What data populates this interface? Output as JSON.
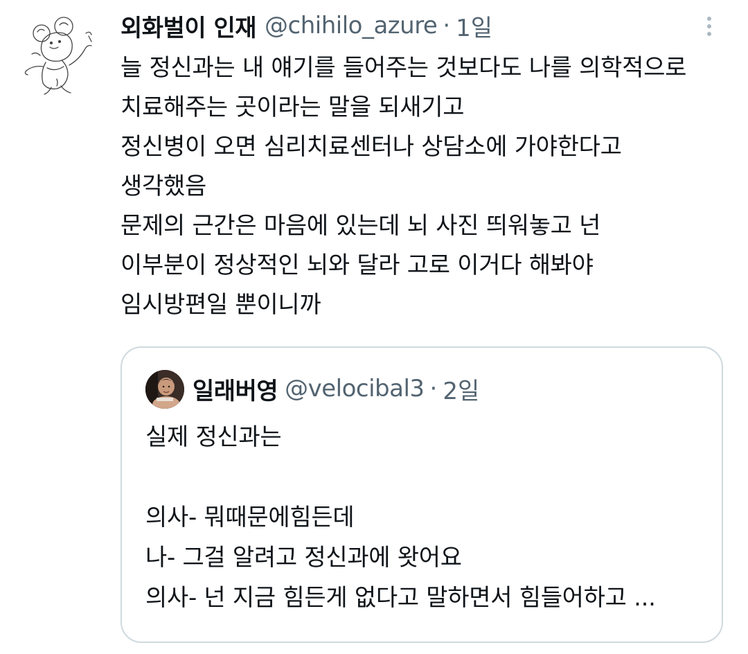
{
  "tweet": {
    "display_name": "외화벌이 인재",
    "handle": "@chihilo_azure",
    "separator": "·",
    "time": "1일",
    "avatar_icon": "sketch-mouse-avatar-icon",
    "more_icon": "more-options-icon",
    "lines": [
      "늘 정신과는 내 얘기를 들어주는 것보다도 나를 의학적으로",
      "치료해주는 곳이라는 말을 되새기고",
      "정신병이 오면 심리치료센터나 상담소에 가야한다고",
      "생각했음",
      "문제의 근간은 마음에 있는데 뇌 사진 띄워놓고 넌",
      "이부분이 정상적인 뇌와 달라 고로 이거다 해봐야",
      "임시방편일 뿐이니까"
    ]
  },
  "quoted": {
    "display_name": "일래버영",
    "handle": "@velocibal3",
    "separator": "·",
    "time": "2일",
    "avatar_icon": "person-photo-avatar-icon",
    "lines": [
      "실제 정신과는",
      "",
      "의사- 뭐때문에힘든데",
      "나- 그걸 알려고 정신과에 왓어요",
      "의사- 넌 지금 힘든게 없다고 말하면서 힘들어하고 ..."
    ]
  },
  "colors": {
    "text": "#0f1419",
    "secondary": "#536471",
    "border": "#cfd9de"
  }
}
